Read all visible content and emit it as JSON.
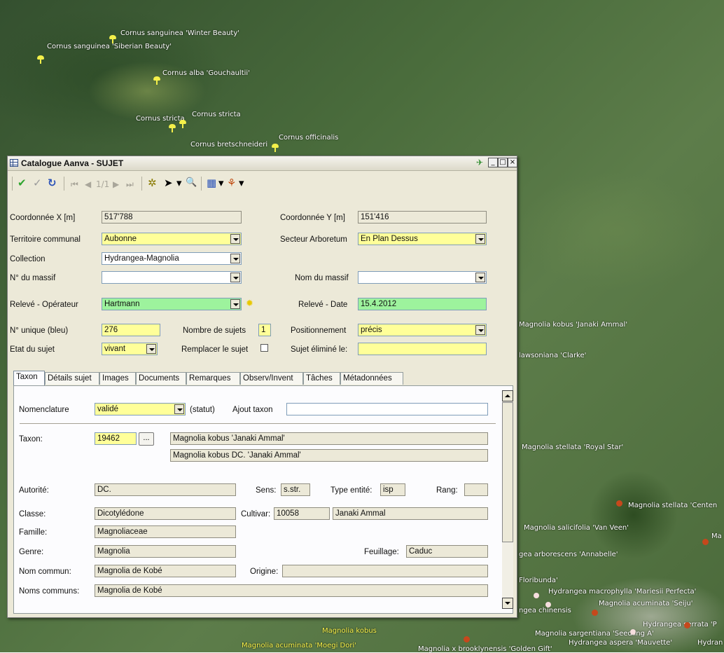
{
  "map": {
    "labels": [
      "Cornus sanguinea 'Winter Beauty'",
      "Cornus sanguinea 'Siberian Beauty'",
      "Cornus alba 'Gouchaultii'",
      "Cornus stricta",
      "Cornus stricta",
      "Cornus bretschneideri",
      "Cornus officinalis",
      "Magnolia kobus 'Janaki Ammal'",
      "lawsoniana 'Clarke'",
      "Magnolia stellata 'Royal Star'",
      "Magnolia stellata 'Centen",
      "Magnolia salicifolia 'Van Veen'",
      "Ma",
      "gea arborescens 'Annabelle'",
      "Floribunda'",
      "Hydrangea macrophylla 'Mariesii Perfecta'",
      "Magnolia acuminata 'Seiju'",
      "ngea chinensis",
      "Hydrangea serrata 'P",
      "Magnolia sargentiana 'Seedling A'",
      "Hydrangea aspera 'Mauvette'",
      "Hydran",
      "Magnolia kobus",
      "Magnolia acuminata 'Moegi Dori'",
      "Magnolia x brooklynensis 'Golden Gift'"
    ]
  },
  "window": {
    "title": "Catalogue Aanva - SUJET",
    "controls": {
      "minimize": "_",
      "maximize": "□",
      "close": "×",
      "pin": "✈"
    }
  },
  "toolbar": {
    "record": "1/1",
    "icons": {
      "save": "✔",
      "validate": "✓",
      "refresh": "↻",
      "first": "⏮",
      "prev": "◀",
      "next": "▶",
      "last": "⏭",
      "highlight": "✲",
      "pointer": "➤",
      "dropdown": "▾",
      "zoom": "🔍",
      "layout": "▦",
      "print": "⚘"
    }
  },
  "form": {
    "coord_x_label": "Coordonnée X [m]",
    "coord_x": "517'788",
    "coord_y_label": "Coordonnée Y [m]",
    "coord_y": "151'416",
    "territoire_label": "Territoire communal",
    "territoire": "Aubonne",
    "secteur_label": "Secteur Arboretum",
    "secteur": "En Plan Dessus",
    "collection_label": "Collection",
    "collection": "Hydrangea-Magnolia",
    "massif_no_label": "N° du massif",
    "massif_no": "",
    "massif_nom_label": "Nom du massif",
    "massif_nom": "",
    "operateur_label": "Relevé - Opérateur",
    "operateur": "Hartmann",
    "date_label": "Relevé - Date",
    "date": "15.4.2012",
    "unique_label": "N° unique (bleu)",
    "unique": "276",
    "nombre_label": "Nombre de sujets",
    "nombre": "1",
    "position_label": "Positionnement",
    "position": "précis",
    "etat_label": "Etat du sujet",
    "etat": "vivant",
    "remplacer_label": "Remplacer le sujet",
    "elimine_label": "Sujet éliminé le:",
    "elimine": ""
  },
  "tabs": [
    "Taxon",
    "Détails sujet",
    "Images",
    "Documents",
    "Remarques",
    "Observ/Invent",
    "Tâches",
    "Métadonnées"
  ],
  "taxon": {
    "nomenclature_label": "Nomenclature",
    "nomenclature": "validé",
    "statut_label": "(statut)",
    "ajout_label": "Ajout taxon",
    "ajout": "",
    "taxon_label": "Taxon:",
    "taxon_id": "19462",
    "browse": "...",
    "taxon_name": "Magnolia kobus 'Janaki Ammal'",
    "taxon_full": "Magnolia kobus DC. 'Janaki Ammal'",
    "autorite_label": "Autorité:",
    "autorite": "DC.",
    "sens_label": "Sens:",
    "sens": "s.str.",
    "type_label": "Type entité:",
    "type": "isp",
    "rang_label": "Rang:",
    "rang": "",
    "classe_label": "Classe:",
    "classe": "Dicotylédone",
    "cultivar_label": "Cultivar:",
    "cultivar_id": "10058",
    "cultivar_name": "Janaki Ammal",
    "famille_label": "Famille:",
    "famille": "Magnoliaceae",
    "genre_label": "Genre:",
    "genre": "Magnolia",
    "feuillage_label": "Feuillage:",
    "feuillage": "Caduc",
    "nom_commun_label": "Nom commun:",
    "nom_commun": "Magnolia de Kobé",
    "origine_label": "Origine:",
    "origine": "",
    "noms_communs_label": "Noms communs:",
    "noms_communs": "Magnolia de Kobé"
  }
}
